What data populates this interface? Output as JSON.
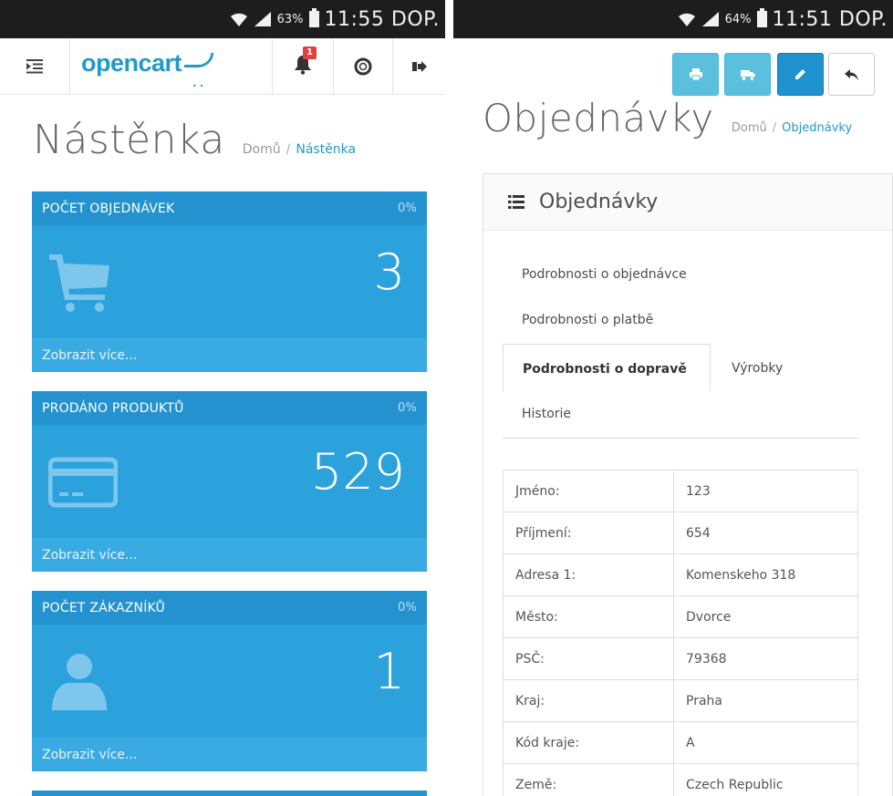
{
  "left": {
    "status": {
      "battery": "63%",
      "time": "11:55 DOP."
    },
    "header": {
      "logo": "opencart",
      "notifications_count": "1"
    },
    "page": {
      "title": "Nástěnka",
      "breadcrumb": [
        "Domů",
        "Nástěnka"
      ]
    },
    "tiles": [
      {
        "title": "POČET OBJEDNÁVEK",
        "percent": "0%",
        "value": "3",
        "icon": "shopping-cart-icon",
        "link": "Zobrazit více..."
      },
      {
        "title": "PRODÁNO PRODUKTŮ",
        "percent": "0%",
        "value": "529",
        "icon": "credit-card-icon",
        "link": "Zobrazit více..."
      },
      {
        "title": "POČET ZÁKAZNÍKŮ",
        "percent": "0%",
        "value": "1",
        "icon": "user-icon",
        "link": "Zobrazit více..."
      }
    ]
  },
  "right": {
    "status": {
      "battery": "64%",
      "time": "11:51 DOP."
    },
    "toolbar": [
      "print-icon",
      "truck-icon",
      "pencil-icon",
      "reply-icon"
    ],
    "page": {
      "title": "Objednávky",
      "breadcrumb": [
        "Domů",
        "Objednávky"
      ]
    },
    "panel_title": "Objednávky",
    "tabs": [
      "Podrobnosti o objednávce",
      "Podrobnosti o platbě",
      "Podrobnosti o dopravě",
      "Výrobky",
      "Historie"
    ],
    "active_tab": "Podrobnosti o dopravě",
    "details": [
      {
        "label": "Jméno:",
        "value": "123"
      },
      {
        "label": "Příjmení:",
        "value": "654"
      },
      {
        "label": "Adresa 1:",
        "value": "Komenskeho 318"
      },
      {
        "label": "Město:",
        "value": "Dvorce"
      },
      {
        "label": "PSČ:",
        "value": "79368"
      },
      {
        "label": "Kraj:",
        "value": "Praha"
      },
      {
        "label": "Kód kraje:",
        "value": "A"
      },
      {
        "label": "Země:",
        "value": "Czech Republic"
      }
    ]
  },
  "colors": {
    "accent": "#229ac8",
    "tile": "#2ca2dd",
    "tile_head": "#2492cf",
    "badge": "#e23f3f"
  }
}
